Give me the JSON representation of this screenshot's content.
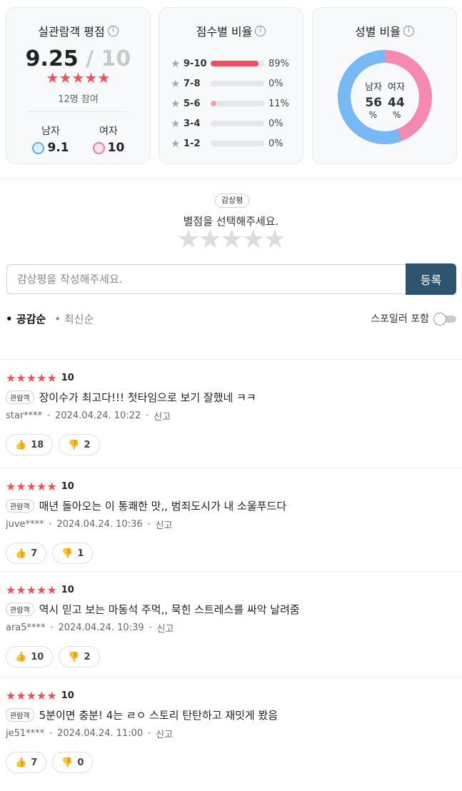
{
  "rating_card": {
    "title": "실관람객 평점",
    "info": "i",
    "score": "9.25",
    "score_max": "/ 10",
    "stars": "★★★★★",
    "participants": "12명 참여",
    "male_label": "남자",
    "male_score": "9.1",
    "female_label": "여자",
    "female_score": "10"
  },
  "distribution_card": {
    "title": "점수별 비율",
    "info": "i",
    "rows": [
      {
        "range": "9-10",
        "percent": "89%",
        "fill": 0.89
      },
      {
        "range": "7-8",
        "percent": "0%",
        "fill": 0
      },
      {
        "range": "5-6",
        "percent": "11%",
        "fill": 0.11
      },
      {
        "range": "3-4",
        "percent": "0%",
        "fill": 0
      },
      {
        "range": "1-2",
        "percent": "0%",
        "fill": 0
      }
    ]
  },
  "gender_card": {
    "title": "성별 비율",
    "info": "i",
    "male_label": "남자",
    "female_label": "여자",
    "male_value": "56",
    "female_value": "44",
    "unit": "%",
    "male_fraction": 0.56,
    "male_color": "#76b9f5",
    "female_color": "#f589b2"
  },
  "write": {
    "tag": "감상평",
    "prompt": "별점을 선택해주세요.",
    "empty_stars": "★★★★★",
    "placeholder": "감상평을 작성해주세요.",
    "submit": "등록"
  },
  "sort": {
    "active": "공감순",
    "inactive": "최신순",
    "spoiler_label": "스포일러 포함"
  },
  "reviews": [
    {
      "stars": "★★★★★",
      "score": "10",
      "badge": "관람객",
      "text": "장이수가 최고다!!! 첫타임으로 보기 잘했네 ㅋㅋ",
      "user": "star****",
      "date": "2024.04.24. 10:22",
      "report": "신고",
      "likes": "18",
      "dislikes": "2"
    },
    {
      "stars": "★★★★★",
      "score": "10",
      "badge": "관람객",
      "text": "매년 돌아오는 이 통쾌한 맛,, 범죄도시가 내 소울푸드다",
      "user": "juve****",
      "date": "2024.04.24. 10:36",
      "report": "신고",
      "likes": "7",
      "dislikes": "1"
    },
    {
      "stars": "★★★★★",
      "score": "10",
      "badge": "관람객",
      "text": "역시 믿고 보는 마동석 주먹,, 묵힌 스트레스를 싸악 날려줌",
      "user": "ara5****",
      "date": "2024.04.24. 10:39",
      "report": "신고",
      "likes": "10",
      "dislikes": "2"
    },
    {
      "stars": "★★★★★",
      "score": "10",
      "badge": "관람객",
      "text": "5분이면 충분! 4는 ㄹㅇ 스토리 탄탄하고 재밋게 봤음",
      "user": "je51****",
      "date": "2024.04.24. 11:00",
      "report": "신고",
      "likes": "7",
      "dislikes": "0"
    }
  ],
  "colors": {
    "accent_red": "#f24e5b",
    "submit_bg": "#2d5570"
  }
}
